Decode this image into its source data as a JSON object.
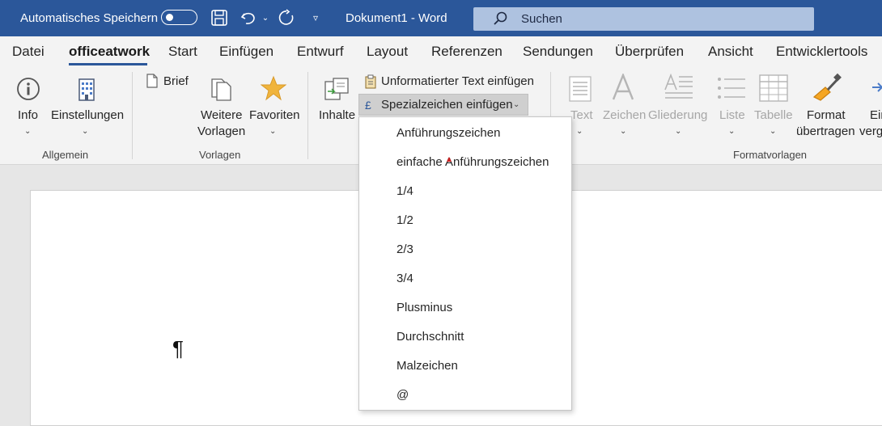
{
  "titlebar": {
    "autosave_label": "Automatisches Speichern",
    "doc_title": "Dokument1  -  Word",
    "search_placeholder": "Suchen"
  },
  "tabs": [
    "Datei",
    "officeatwork",
    "Start",
    "Einfügen",
    "Entwurf",
    "Layout",
    "Referenzen",
    "Sendungen",
    "Überprüfen",
    "Ansicht",
    "Entwicklertools"
  ],
  "active_tab": "officeatwork",
  "ribbon": {
    "info": "Info",
    "einstellungen": "Einstellungen",
    "group_allgemein": "Allgemein",
    "brief": "Brief",
    "weitere_1": "Weitere",
    "weitere_2": "Vorlagen",
    "favoriten": "Favoriten",
    "group_vorlagen": "Vorlagen",
    "inhalte": "Inhalte",
    "unformatiert": "Unformatierter Text einfügen",
    "spezialzeichen": "Spezialzeichen einfügen",
    "text": "Text",
    "zeichen": "Zeichen",
    "gliederung": "Gliederung",
    "liste": "Liste",
    "tabelle": "Tabelle",
    "format_1": "Format",
    "format_2": "übertragen",
    "ein_1": "Ein",
    "ein_2": "verg",
    "group_formatvorlagen": "Formatvorlagen"
  },
  "dropdown_items": [
    "Anführungszeichen",
    "einfache Anführungszeichen",
    "1/4",
    "1/2",
    "2/3",
    "3/4",
    "Plusminus",
    "Durchschnitt",
    "Malzeichen",
    "@"
  ],
  "document": {
    "pilcrow": "¶"
  },
  "colors": {
    "titlebar": "#2b579a",
    "search": "#aec2e0",
    "ribbon": "#f3f3f3",
    "favorite_star": "#f0b43c"
  }
}
